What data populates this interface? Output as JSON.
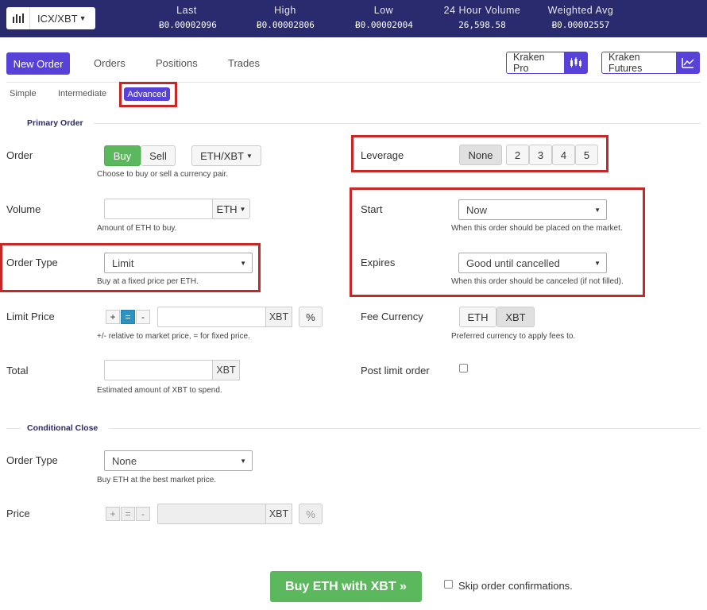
{
  "header": {
    "pair": "ICX/XBT",
    "stats": [
      {
        "label": "Last",
        "value": "Ƀ0.00002096"
      },
      {
        "label": "High",
        "value": "Ƀ0.00002806"
      },
      {
        "label": "Low",
        "value": "Ƀ0.00002004"
      },
      {
        "label": "24 Hour Volume",
        "value": "26,598.58"
      },
      {
        "label": "Weighted Avg",
        "value": "Ƀ0.00002557"
      }
    ]
  },
  "nav": {
    "active": "New Order",
    "items": [
      "Orders",
      "Positions",
      "Trades"
    ],
    "kraken_pro": "Kraken Pro",
    "kraken_futures": "Kraken Futures"
  },
  "subtabs": {
    "simple": "Simple",
    "intermediate": "Intermediate",
    "advanced": "Advanced"
  },
  "primary": {
    "title": "Primary Order",
    "order_label": "Order",
    "buy": "Buy",
    "sell": "Sell",
    "pair": "ETH/XBT",
    "order_hint": "Choose to buy or sell a currency pair.",
    "volume_label": "Volume",
    "volume_unit": "ETH",
    "volume_hint": "Amount of ETH to buy.",
    "order_type_label": "Order Type",
    "order_type_value": "Limit",
    "order_type_hint": "Buy at a fixed price per ETH.",
    "limit_price_label": "Limit Price",
    "limit_unit": "XBT",
    "limit_hint": "+/- relative to market price, = for fixed price.",
    "total_label": "Total",
    "total_unit": "XBT",
    "total_hint": "Estimated amount of XBT to spend.",
    "leverage_label": "Leverage",
    "leverage_options": [
      "None",
      "2",
      "3",
      "4",
      "5"
    ],
    "start_label": "Start",
    "start_value": "Now",
    "start_hint": "When this order should be placed on the market.",
    "expires_label": "Expires",
    "expires_value": "Good until cancelled",
    "expires_hint": "When this order should be canceled (if not filled).",
    "fee_label": "Fee Currency",
    "fee_options": [
      "ETH",
      "XBT"
    ],
    "fee_hint": "Preferred currency to apply fees to.",
    "post_limit_label": "Post limit order"
  },
  "conditional": {
    "title": "Conditional Close",
    "order_type_label": "Order Type",
    "order_type_value": "None",
    "order_type_hint": "Buy ETH at the best market price.",
    "price_label": "Price",
    "price_unit": "XBT"
  },
  "footer": {
    "submit": "Buy ETH with XBT »",
    "skip_label": "Skip order confirmations."
  }
}
